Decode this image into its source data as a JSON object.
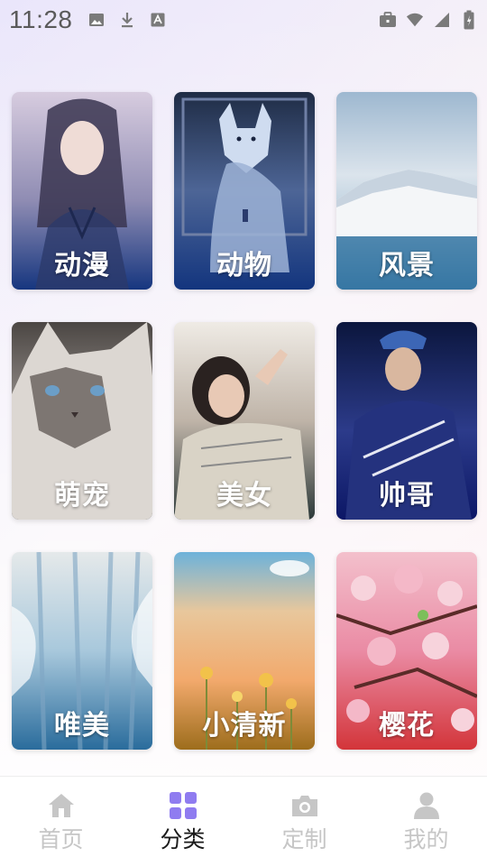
{
  "status_bar": {
    "time": "11:28",
    "left_icons": [
      "image-icon",
      "download-icon",
      "font-icon"
    ],
    "right_icons": [
      "briefcase-icon",
      "wifi-icon",
      "signal-icon",
      "battery-icon"
    ]
  },
  "categories": [
    {
      "label": "动漫",
      "icon": "anime-girl-art",
      "colors": [
        "#c9bfd8",
        "#7b7aa3",
        "#1e3f88"
      ]
    },
    {
      "label": "动物",
      "icon": "fox-art",
      "colors": [
        "#2c3c5c",
        "#5f7ab0",
        "#153a86"
      ]
    },
    {
      "label": "风景",
      "icon": "snow-mountain-art",
      "colors": [
        "#a7bfd5",
        "#dfe7ee",
        "#2f6f9f"
      ]
    },
    {
      "label": "萌宠",
      "icon": "cat-art",
      "colors": [
        "#5a5552",
        "#c9c6c2",
        "#2c3a3a"
      ]
    },
    {
      "label": "美女",
      "icon": "woman-art",
      "colors": [
        "#e9e4dc",
        "#7c6e62",
        "#2d3a3a"
      ]
    },
    {
      "label": "帅哥",
      "icon": "man-art",
      "colors": [
        "#0d1844",
        "#3a4aa2",
        "#0e1a6a"
      ]
    },
    {
      "label": "唯美",
      "icon": "frozen-forest-art",
      "colors": [
        "#dfe6ea",
        "#9cc0d8",
        "#2d6e9e"
      ]
    },
    {
      "label": "小清新",
      "icon": "sunset-flowers-art",
      "colors": [
        "#6fb3db",
        "#f4b278",
        "#a3741f"
      ]
    },
    {
      "label": "樱花",
      "icon": "cherry-blossom-art",
      "colors": [
        "#f1b5c3",
        "#e56a8a",
        "#d7373b"
      ]
    }
  ],
  "bottom_nav": [
    {
      "label": "首页",
      "icon": "home-icon",
      "active": false
    },
    {
      "label": "分类",
      "icon": "category-icon",
      "active": true
    },
    {
      "label": "定制",
      "icon": "camera-icon",
      "active": false
    },
    {
      "label": "我的",
      "icon": "user-icon",
      "active": false
    }
  ],
  "colors": {
    "accent": "#8f7cf0",
    "inactive": "#c6c6c6",
    "active_text": "#1a1a1a"
  }
}
